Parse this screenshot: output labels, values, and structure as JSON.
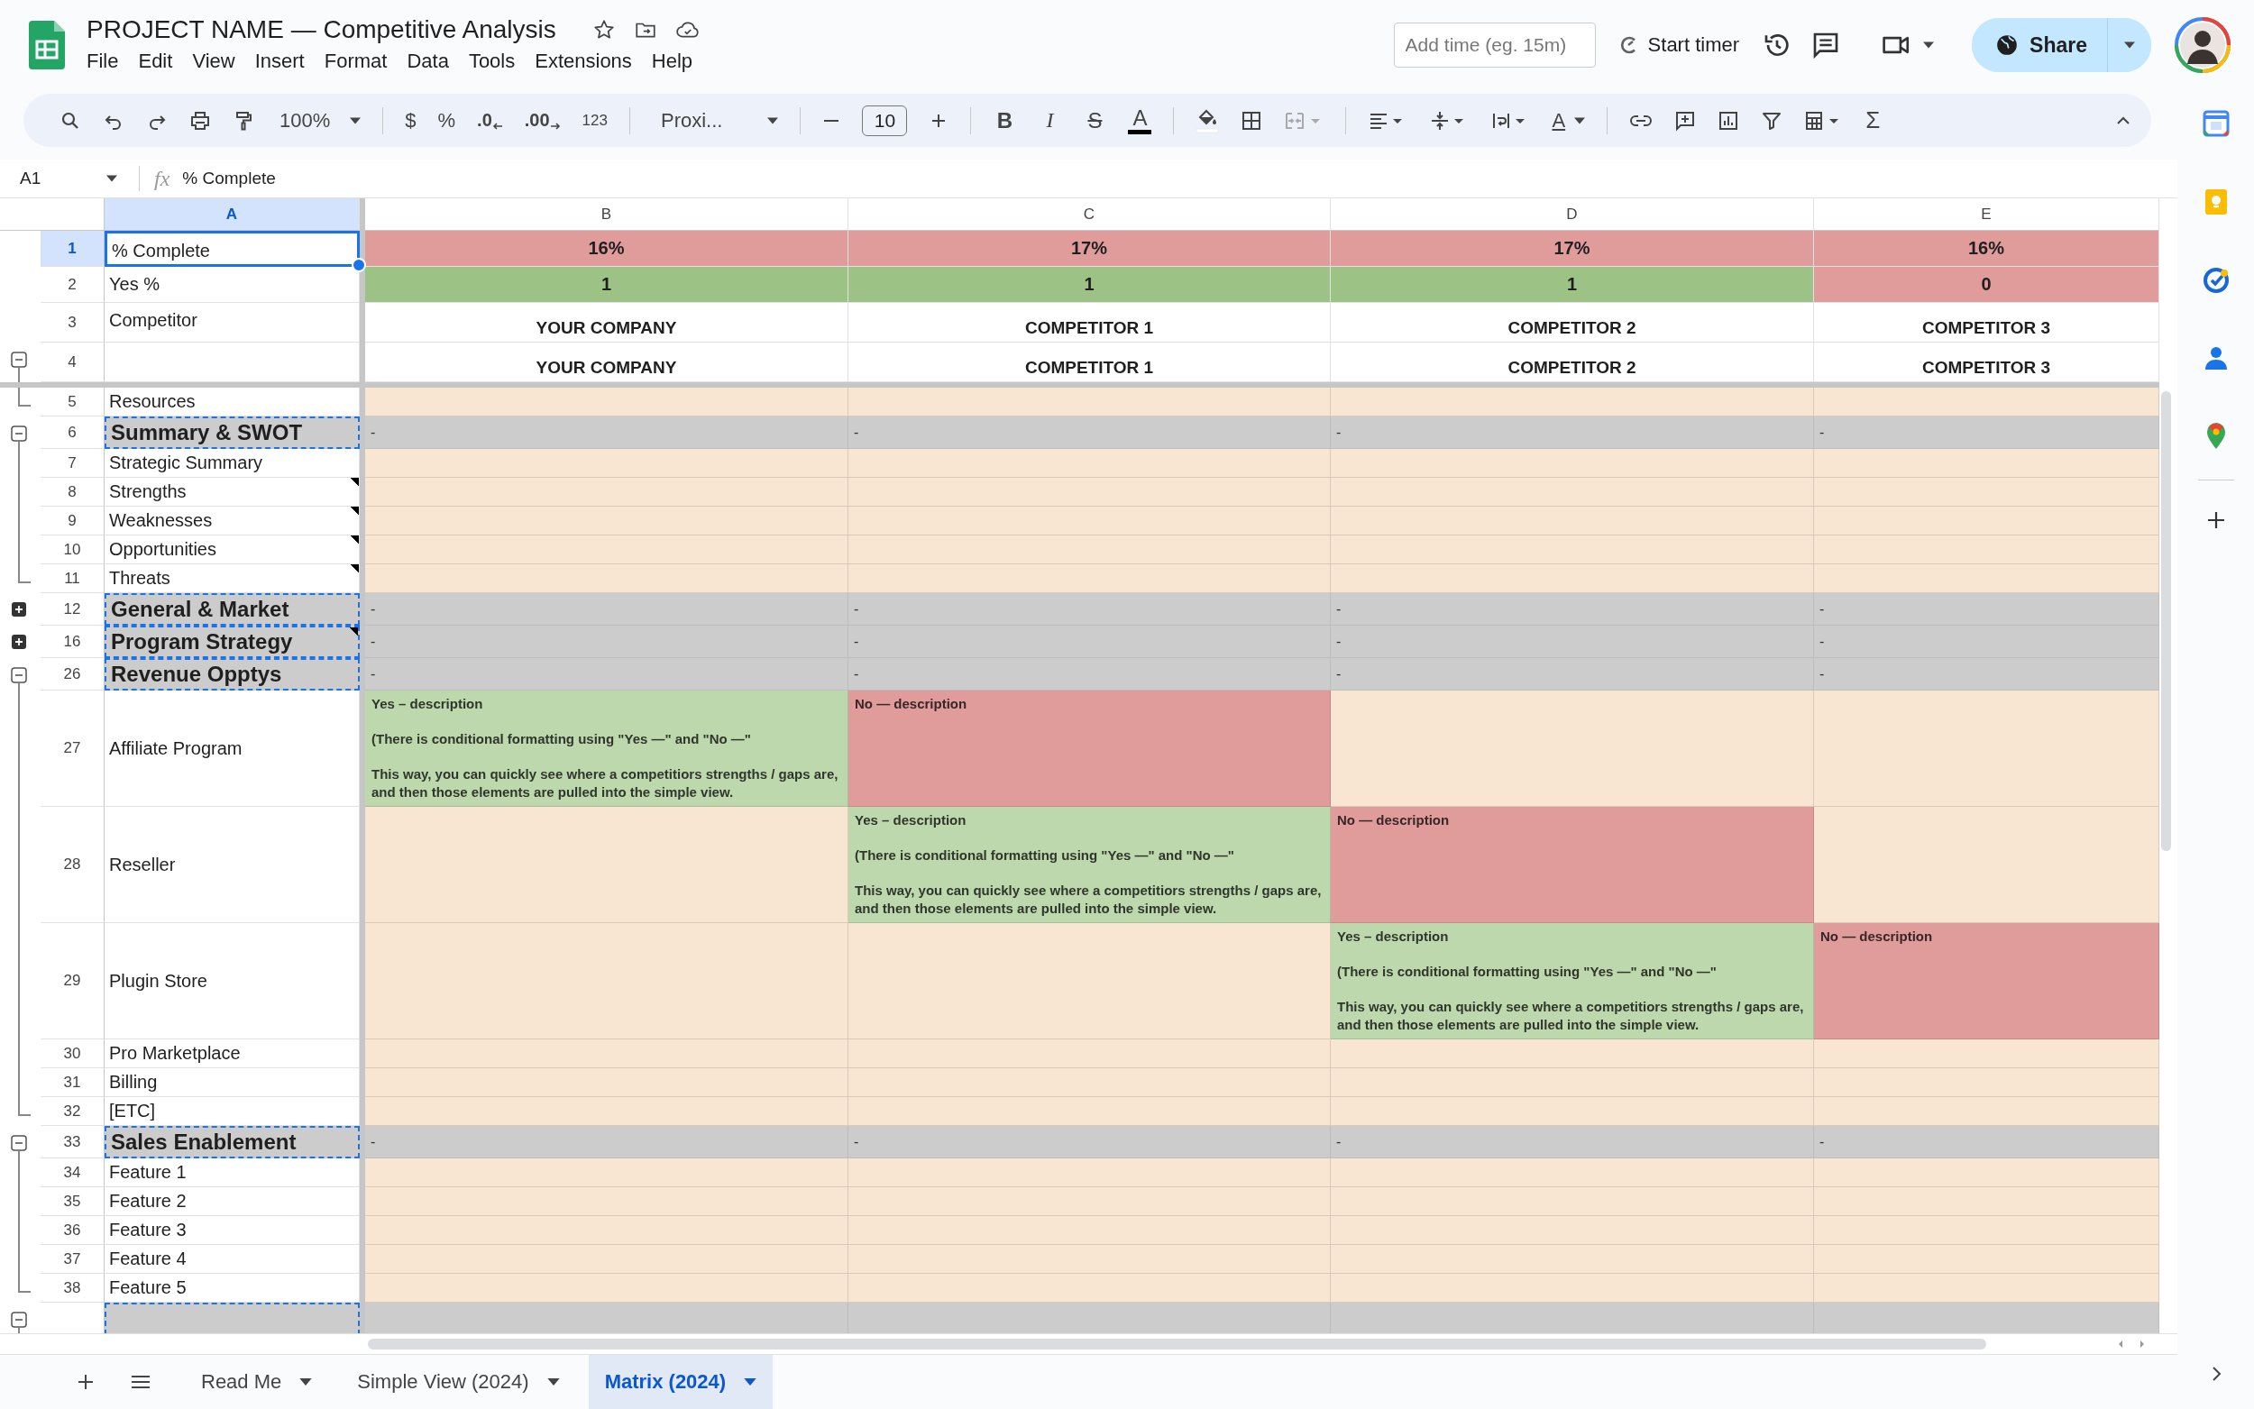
{
  "document": {
    "title": "PROJECT NAME — Competitive Analysis"
  },
  "menu": [
    "File",
    "Edit",
    "View",
    "Insert",
    "Format",
    "Data",
    "Tools",
    "Extensions",
    "Help"
  ],
  "header_controls": {
    "time_field": {
      "placeholder": "Add time (eg. 15m)"
    },
    "timer_button": "Start timer",
    "share_button": "Share"
  },
  "toolbar": {
    "zoom": "100%",
    "currency": "$",
    "percent": "%",
    "decrease_decimal": ".0",
    "increase_decimal": ".00",
    "number_format": "123",
    "font": "Proxi...",
    "font_size": "10",
    "bold": "B",
    "italic": "I",
    "strikethrough": "S",
    "text_color": "A",
    "text_rotation": "A",
    "functions": "Σ"
  },
  "formula_bar": {
    "cell_ref": "A1",
    "fx": "fx",
    "content": "% Complete"
  },
  "columns": [
    {
      "label": "A",
      "selected": true
    },
    {
      "label": "B",
      "selected": false
    },
    {
      "label": "C",
      "selected": false
    },
    {
      "label": "D",
      "selected": false
    },
    {
      "label": "E",
      "selected": false
    }
  ],
  "frozen_rows": [
    {
      "number": "1",
      "label": "% Complete",
      "kind": "summary",
      "selected": true,
      "note": false,
      "cells": [
        {
          "text": "16%",
          "color": "#e09c9b"
        },
        {
          "text": "17%",
          "color": "#e09c9b"
        },
        {
          "text": "17%",
          "color": "#e09c9b"
        },
        {
          "text": "16%",
          "color": "#e09c9b"
        }
      ]
    },
    {
      "number": "2",
      "label": "Yes %",
      "kind": "summary",
      "selected": false,
      "note": false,
      "cells": [
        {
          "text": "1",
          "color": "#9cc286"
        },
        {
          "text": "1",
          "color": "#9cc286"
        },
        {
          "text": "1",
          "color": "#9cc286"
        },
        {
          "text": "0",
          "color": "#e09c9b"
        }
      ]
    },
    {
      "number": "3",
      "label": "Competitor",
      "kind": "summary",
      "selected": false,
      "note": false,
      "cells": [
        {
          "text": "YOUR COMPANY",
          "color": "#ffffff"
        },
        {
          "text": "COMPETITOR 1",
          "color": "#ffffff"
        },
        {
          "text": "COMPETITOR 2",
          "color": "#ffffff"
        },
        {
          "text": "COMPETITOR 3",
          "color": "#ffffff"
        }
      ]
    },
    {
      "number": "4",
      "kind": "summary",
      "selected": false,
      "note": false,
      "expanded": true,
      "cells": [
        {
          "text": "YOUR COMPANY",
          "color": "#ffffff"
        },
        {
          "text": "COMPETITOR 1",
          "color": "#ffffff"
        },
        {
          "text": "COMPETITOR 2",
          "color": "#ffffff"
        },
        {
          "text": "COMPETITOR 3",
          "color": "#ffffff"
        }
      ]
    }
  ],
  "rows": [
    {
      "number": "5",
      "label": "Resources",
      "kind": "item",
      "selected": false,
      "note": false,
      "cells": [
        {
          "color": "#f9e6d2"
        },
        {
          "color": "#f9e6d2"
        },
        {
          "color": "#f9e6d2"
        },
        {
          "color": "#f9e6d2"
        }
      ]
    },
    {
      "number": "6",
      "label": "Summary & SWOT",
      "kind": "section",
      "selected": false,
      "note": false,
      "expanded": true,
      "cells": [
        {
          "text": "-"
        },
        {
          "text": "-"
        },
        {
          "text": "-"
        },
        {
          "text": "-"
        }
      ]
    },
    {
      "number": "7",
      "label": "Strategic Summary",
      "kind": "item",
      "selected": false,
      "note": false,
      "cells": [
        {
          "color": "#f9e6d2"
        },
        {
          "color": "#f9e6d2"
        },
        {
          "color": "#f9e6d2"
        },
        {
          "color": "#f9e6d2"
        }
      ]
    },
    {
      "number": "8",
      "label": "Strengths",
      "kind": "item",
      "selected": false,
      "note": true,
      "cells": [
        {
          "color": "#f9e6d2"
        },
        {
          "color": "#f9e6d2"
        },
        {
          "color": "#f9e6d2"
        },
        {
          "color": "#f9e6d2"
        }
      ]
    },
    {
      "number": "9",
      "label": "Weaknesses",
      "kind": "item",
      "selected": false,
      "note": true,
      "cells": [
        {
          "color": "#f9e6d2"
        },
        {
          "color": "#f9e6d2"
        },
        {
          "color": "#f9e6d2"
        },
        {
          "color": "#f9e6d2"
        }
      ]
    },
    {
      "number": "10",
      "label": "Opportunities",
      "kind": "item",
      "selected": false,
      "note": true,
      "cells": [
        {
          "color": "#f9e6d2"
        },
        {
          "color": "#f9e6d2"
        },
        {
          "color": "#f9e6d2"
        },
        {
          "color": "#f9e6d2"
        }
      ]
    },
    {
      "number": "11",
      "label": "Threats",
      "kind": "item",
      "selected": false,
      "note": true,
      "cells": [
        {
          "color": "#f9e6d2"
        },
        {
          "color": "#f9e6d2"
        },
        {
          "color": "#f9e6d2"
        },
        {
          "color": "#f9e6d2"
        }
      ]
    },
    {
      "number": "12",
      "label": "General & Market",
      "kind": "section",
      "selected": false,
      "note": false,
      "expanded": false,
      "cells": [
        {
          "text": "-"
        },
        {
          "text": "-"
        },
        {
          "text": "-"
        },
        {
          "text": "-"
        }
      ]
    },
    {
      "number": "16",
      "label": "Program Strategy",
      "kind": "section",
      "selected": false,
      "note": true,
      "expanded": false,
      "cells": [
        {
          "text": "-"
        },
        {
          "text": "-"
        },
        {
          "text": "-"
        },
        {
          "text": "-"
        }
      ]
    },
    {
      "number": "26",
      "label": "Revenue Opptys",
      "kind": "section",
      "selected": false,
      "note": false,
      "expanded": true,
      "cells": [
        {
          "text": "-"
        },
        {
          "text": "-"
        },
        {
          "text": "-"
        },
        {
          "text": "-"
        }
      ]
    },
    {
      "number": "27",
      "label": "Affiliate Program",
      "kind": "item",
      "selected": false,
      "note": false,
      "cells": [
        {
          "text": "Yes – description\n\n(There is conditional formatting using \"Yes —\" and \"No —\"\n\nThis way, you can quickly see where a competitiors strengths / gaps are, and then those elements are pulled into the simple view.",
          "color": "#bed8ad"
        },
        {
          "text": "No — description",
          "color": "#e09c9b"
        },
        {
          "color": "#f9e6d2"
        },
        {
          "color": "#f9e6d2"
        }
      ]
    },
    {
      "number": "28",
      "label": "Reseller",
      "kind": "item",
      "selected": false,
      "note": false,
      "cells": [
        {
          "color": "#f9e6d2"
        },
        {
          "text": "Yes – description\n\n(There is conditional formatting using \"Yes —\" and \"No —\"\n\nThis way, you can quickly see where a competitiors strengths / gaps are, and then those elements are pulled into the simple view.",
          "color": "#bed8ad"
        },
        {
          "text": "No — description",
          "color": "#e09c9b"
        },
        {
          "color": "#f9e6d2"
        }
      ]
    },
    {
      "number": "29",
      "label": "Plugin Store",
      "kind": "item",
      "selected": false,
      "note": false,
      "cells": [
        {
          "color": "#f9e6d2"
        },
        {
          "color": "#f9e6d2"
        },
        {
          "text": "Yes – description\n\n(There is conditional formatting using \"Yes —\" and \"No —\"\n\nThis way, you can quickly see where a competitiors strengths / gaps are, and then those elements are pulled into the simple view.",
          "color": "#bed8ad"
        },
        {
          "text": "No — description",
          "color": "#e09c9b"
        }
      ]
    },
    {
      "number": "30",
      "label": "Pro Marketplace",
      "kind": "item",
      "selected": false,
      "note": false,
      "cells": [
        {
          "color": "#f9e6d2"
        },
        {
          "color": "#f9e6d2"
        },
        {
          "color": "#f9e6d2"
        },
        {
          "color": "#f9e6d2"
        }
      ]
    },
    {
      "number": "31",
      "label": "Billing",
      "kind": "item",
      "selected": false,
      "note": false,
      "cells": [
        {
          "color": "#f9e6d2"
        },
        {
          "color": "#f9e6d2"
        },
        {
          "color": "#f9e6d2"
        },
        {
          "color": "#f9e6d2"
        }
      ]
    },
    {
      "number": "32",
      "label": "[ETC]",
      "kind": "item",
      "selected": false,
      "note": false,
      "cells": [
        {
          "color": "#f9e6d2"
        },
        {
          "color": "#f9e6d2"
        },
        {
          "color": "#f9e6d2"
        },
        {
          "color": "#f9e6d2"
        }
      ]
    },
    {
      "number": "33",
      "label": "Sales Enablement",
      "kind": "section",
      "selected": false,
      "note": false,
      "expanded": true,
      "cells": [
        {
          "text": "-"
        },
        {
          "text": "-"
        },
        {
          "text": "-"
        },
        {
          "text": "-"
        }
      ]
    },
    {
      "number": "34",
      "label": "Feature 1",
      "kind": "item",
      "selected": false,
      "note": false,
      "cells": [
        {
          "color": "#f9e6d2"
        },
        {
          "color": "#f9e6d2"
        },
        {
          "color": "#f9e6d2"
        },
        {
          "color": "#f9e6d2"
        }
      ]
    },
    {
      "number": "35",
      "label": "Feature 2",
      "kind": "item",
      "selected": false,
      "note": false,
      "cells": [
        {
          "color": "#f9e6d2"
        },
        {
          "color": "#f9e6d2"
        },
        {
          "color": "#f9e6d2"
        },
        {
          "color": "#f9e6d2"
        }
      ]
    },
    {
      "number": "36",
      "label": "Feature 3",
      "kind": "item",
      "selected": false,
      "note": false,
      "cells": [
        {
          "color": "#f9e6d2"
        },
        {
          "color": "#f9e6d2"
        },
        {
          "color": "#f9e6d2"
        },
        {
          "color": "#f9e6d2"
        }
      ]
    },
    {
      "number": "37",
      "label": "Feature 4",
      "kind": "item",
      "selected": false,
      "note": false,
      "cells": [
        {
          "color": "#f9e6d2"
        },
        {
          "color": "#f9e6d2"
        },
        {
          "color": "#f9e6d2"
        },
        {
          "color": "#f9e6d2"
        }
      ]
    },
    {
      "number": "38",
      "label": "Feature 5",
      "kind": "item",
      "selected": false,
      "note": false,
      "cells": [
        {
          "color": "#f9e6d2"
        },
        {
          "color": "#f9e6d2"
        },
        {
          "color": "#f9e6d2"
        },
        {
          "color": "#f9e6d2"
        }
      ]
    },
    {
      "kind": "section",
      "selected": false,
      "expanded": true
    }
  ],
  "sheet_tabs": [
    {
      "label": "Read Me",
      "selected": false
    },
    {
      "label": "Simple View (2024)",
      "selected": false
    },
    {
      "label": "Matrix (2024)",
      "selected": true
    }
  ]
}
